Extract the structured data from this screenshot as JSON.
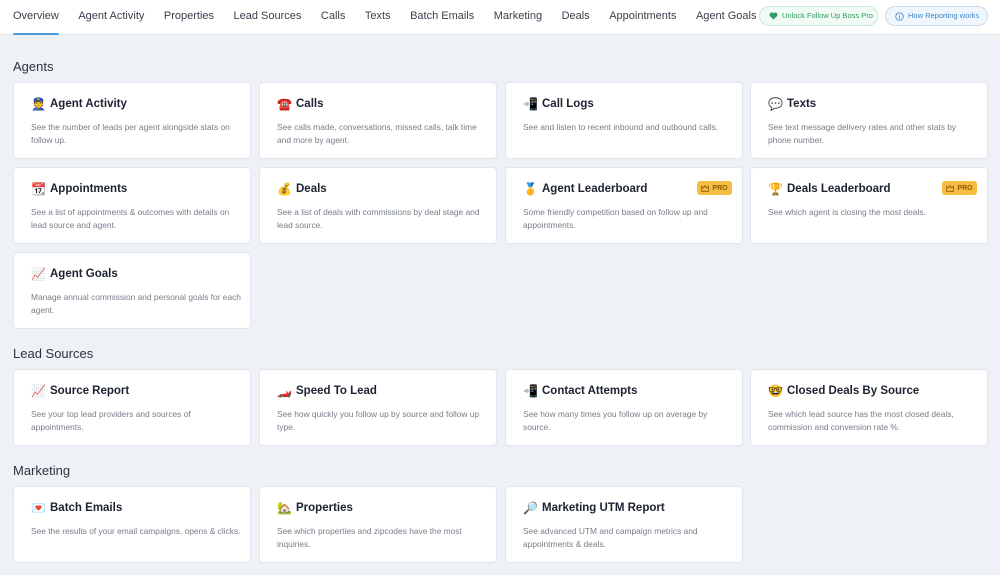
{
  "nav": {
    "tabs": [
      {
        "label": "Overview",
        "active": true
      },
      {
        "label": "Agent Activity"
      },
      {
        "label": "Properties"
      },
      {
        "label": "Lead Sources"
      },
      {
        "label": "Calls"
      },
      {
        "label": "Texts"
      },
      {
        "label": "Batch Emails"
      },
      {
        "label": "Marketing"
      },
      {
        "label": "Deals"
      },
      {
        "label": "Appointments"
      },
      {
        "label": "Agent Goals"
      }
    ],
    "unlock_pro_label": "Unlock Follow Up Boss Pro",
    "how_reporting_label": "How Reporting works"
  },
  "colors": {
    "accent": "#4a9ad8",
    "pro_badge": "#f5bd41",
    "unlock_green": "#2f9c63",
    "background": "#eef1f5"
  },
  "sections": [
    {
      "title": "Agents",
      "cards": [
        {
          "icon": "police-officer-icon",
          "glyph": "👮",
          "title": "Agent Activity",
          "desc": "See the number of leads per agent alongside stats on follow up."
        },
        {
          "icon": "telephone-icon",
          "glyph": "☎️",
          "title": "Calls",
          "desc": "See calls made, conversations, missed calls, talk time and more by agent."
        },
        {
          "icon": "phone-arrow-icon",
          "glyph": "📲",
          "title": "Call Logs",
          "desc": "See and listen to recent inbound and outbound calls."
        },
        {
          "icon": "speech-bubble-icon",
          "glyph": "💬",
          "title": "Texts",
          "desc": "See text message delivery rates and other stats by phone number."
        },
        {
          "icon": "calendar-icon",
          "glyph": "📆",
          "title": "Appointments",
          "desc": "See a list of appointments & outcomes with details on lead source and agent."
        },
        {
          "icon": "money-bag-icon",
          "glyph": "💰",
          "title": "Deals",
          "desc": "See a list of deals with commissions by deal stage and lead source."
        },
        {
          "icon": "medal-icon",
          "glyph": "🥇",
          "title": "Agent Leaderboard",
          "desc": "Some friendly competition based on follow up and appointments.",
          "badge": "PRO"
        },
        {
          "icon": "trophy-icon",
          "glyph": "🏆",
          "title": "Deals Leaderboard",
          "desc": "See which agent is closing the most deals.",
          "badge": "PRO"
        },
        {
          "icon": "chart-increasing-icon",
          "glyph": "📈",
          "title": "Agent Goals",
          "desc": "Manage annual commission and personal goals for each agent."
        }
      ]
    },
    {
      "title": "Lead Sources",
      "cards": [
        {
          "icon": "chart-increasing-icon",
          "glyph": "📈",
          "title": "Source Report",
          "desc": "See your top lead providers and sources of appointments."
        },
        {
          "icon": "race-car-icon",
          "glyph": "🏎️",
          "title": "Speed To Lead",
          "desc": "See how quickly you follow up by source and follow up type."
        },
        {
          "icon": "phone-arrow-icon",
          "glyph": "📲",
          "title": "Contact Attempts",
          "desc": "See how many times you follow up on average by source."
        },
        {
          "icon": "nerd-face-icon",
          "glyph": "🤓",
          "title": "Closed Deals By Source",
          "desc": "See which lead source has the most closed deals, commission and conversion rate %."
        }
      ]
    },
    {
      "title": "Marketing",
      "cards": [
        {
          "icon": "love-letter-icon",
          "glyph": "💌",
          "title": "Batch Emails",
          "desc": "See the results of your email campaigns, opens & clicks."
        },
        {
          "icon": "house-garden-icon",
          "glyph": "🏡",
          "title": "Properties",
          "desc": "See which properties and zipcodes have the most inquiries."
        },
        {
          "icon": "magnifying-glass-icon",
          "glyph": "🔎",
          "title": "Marketing UTM Report",
          "desc": "See advanced UTM and campaign metrics and appointments & deals."
        }
      ]
    }
  ]
}
